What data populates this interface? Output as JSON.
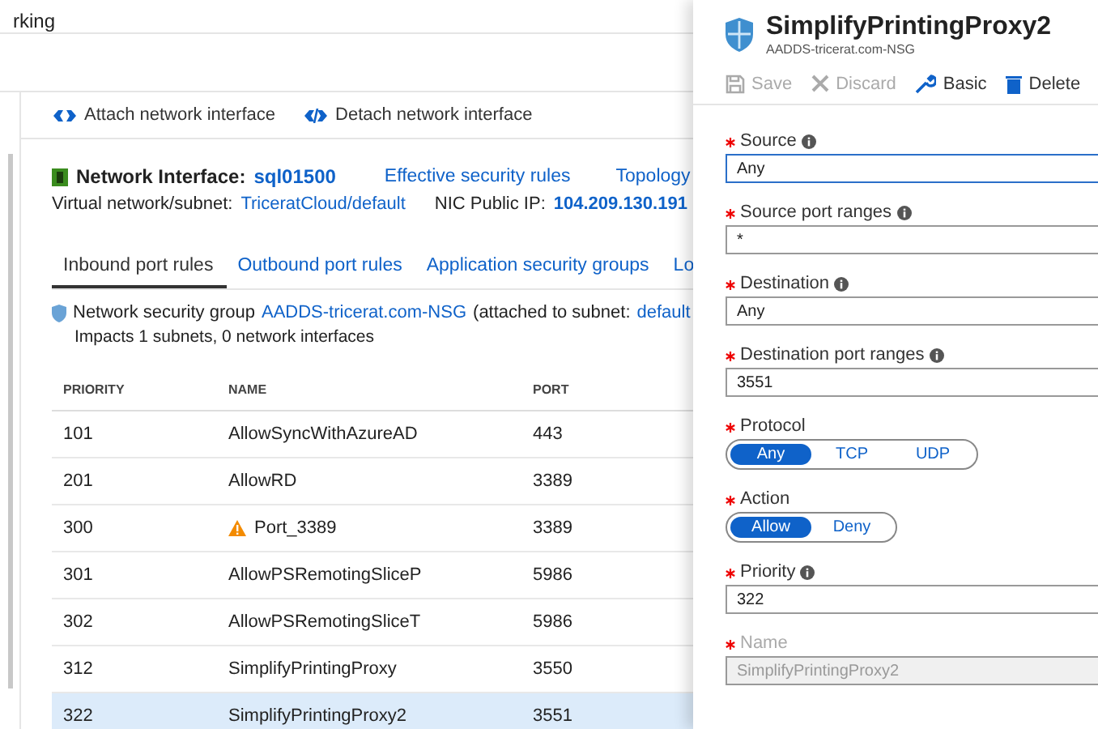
{
  "breadcrumb": "rking",
  "toolbar": [
    {
      "label": "Attach network interface"
    },
    {
      "label": "Detach network interface"
    }
  ],
  "nic": {
    "label": "Network Interface:",
    "name": "sql01500",
    "links": [
      "Effective security rules",
      "Topology"
    ],
    "subnet_label": "Virtual network/subnet:",
    "subnet": "TriceratCloud/default",
    "ip_label": "NIC Public IP:",
    "ip": "104.209.130.191"
  },
  "tabs": [
    {
      "label": "Inbound port rules",
      "selected": true
    },
    {
      "label": "Outbound port rules",
      "selected": false
    },
    {
      "label": "Application security groups",
      "selected": false
    },
    {
      "label": "Lo",
      "selected": false
    }
  ],
  "nsg": {
    "prefix": "Network security group",
    "name": "AADDS-tricerat.com-NSG",
    "middle": "(attached to subnet:",
    "subnet": "default",
    "impacts": "Impacts 1 subnets, 0 network interfaces"
  },
  "table": {
    "columns": [
      "PRIORITY",
      "NAME",
      "PORT"
    ],
    "rows": [
      {
        "priority": "101",
        "name": "AllowSyncWithAzureAD",
        "port": "443",
        "warning": false,
        "selected": false
      },
      {
        "priority": "201",
        "name": "AllowRD",
        "port": "3389",
        "warning": false,
        "selected": false
      },
      {
        "priority": "300",
        "name": "Port_3389",
        "port": "3389",
        "warning": true,
        "selected": false
      },
      {
        "priority": "301",
        "name": "AllowPSRemotingSliceP",
        "port": "5986",
        "warning": false,
        "selected": false
      },
      {
        "priority": "302",
        "name": "AllowPSRemotingSliceT",
        "port": "5986",
        "warning": false,
        "selected": false
      },
      {
        "priority": "312",
        "name": "SimplifyPrintingProxy",
        "port": "3550",
        "warning": false,
        "selected": false
      },
      {
        "priority": "322",
        "name": "SimplifyPrintingProxy2",
        "port": "3551",
        "warning": false,
        "selected": true
      }
    ]
  },
  "blade": {
    "title": "SimplifyPrintingProxy2",
    "subtitle": "AADDS-tricerat.com-NSG",
    "commands": [
      {
        "kind": "save",
        "label": "Save",
        "disabled": true
      },
      {
        "kind": "discard",
        "label": "Discard",
        "disabled": true
      },
      {
        "kind": "basic",
        "label": "Basic",
        "disabled": false
      },
      {
        "kind": "delete",
        "label": "Delete",
        "disabled": false
      }
    ],
    "fields": [
      {
        "kind": "input",
        "required": true,
        "label": "Source",
        "info": true,
        "value": "Any",
        "focused": true,
        "disabled": false
      },
      {
        "kind": "input",
        "required": true,
        "label": "Source port ranges",
        "info": true,
        "value": "*",
        "focused": false,
        "disabled": false
      },
      {
        "kind": "input",
        "required": true,
        "label": "Destination",
        "info": true,
        "value": "Any",
        "focused": false,
        "disabled": false
      },
      {
        "kind": "input",
        "required": true,
        "label": "Destination port ranges",
        "info": true,
        "value": "3551",
        "focused": false,
        "disabled": false
      },
      {
        "kind": "toggle",
        "required": true,
        "label": "Protocol",
        "info": false,
        "options": [
          {
            "label": "Any",
            "selected": true
          },
          {
            "label": "TCP",
            "selected": false
          },
          {
            "label": "UDP",
            "selected": false
          }
        ]
      },
      {
        "kind": "toggle",
        "required": true,
        "label": "Action",
        "info": false,
        "options": [
          {
            "label": "Allow",
            "selected": true
          },
          {
            "label": "Deny",
            "selected": false
          }
        ]
      },
      {
        "kind": "input",
        "required": true,
        "label": "Priority",
        "info": true,
        "value": "322",
        "focused": false,
        "disabled": false
      },
      {
        "kind": "input",
        "required": true,
        "label": "Name",
        "info": false,
        "value": "SimplifyPrintingProxy2",
        "focused": false,
        "disabled": true
      }
    ]
  }
}
